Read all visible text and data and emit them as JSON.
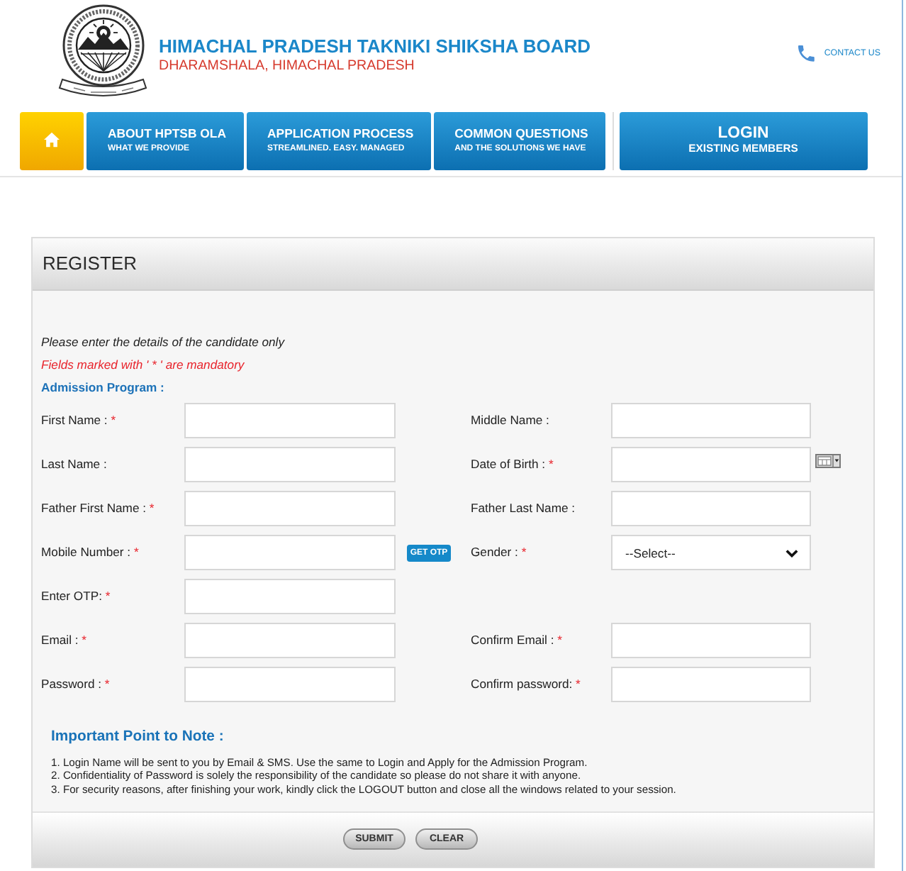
{
  "header": {
    "title": "HIMACHAL PRADESH TAKNIKI SHIKSHA BOARD",
    "subtitle": "DHARAMSHALA, HIMACHAL PRADESH",
    "contact": "CONTACT US"
  },
  "nav": [
    {
      "kind": "home",
      "selected": true
    },
    {
      "kind": "link",
      "label": "ABOUT HPTSB OLA",
      "sublabel": "WHAT WE PROVIDE",
      "selected": false
    },
    {
      "kind": "link",
      "label": "APPLICATION PROCESS",
      "sublabel": "STREAMLINED. EASY. MANAGED",
      "selected": false
    },
    {
      "kind": "link",
      "label": "COMMON QUESTIONS",
      "sublabel": "AND THE SOLUTIONS WE HAVE",
      "selected": false
    },
    {
      "kind": "login",
      "label": "LOGIN",
      "sublabel": "EXISTING MEMBERS",
      "selected": false
    }
  ],
  "register": {
    "title": "REGISTER",
    "intro": "Please enter the details of the candidate only",
    "mandatory_note": "Fields marked with ' * ' are mandatory",
    "section": "Admission Program :",
    "rows": [
      {
        "left": {
          "kind": "text",
          "label": "First Name :",
          "mark": "*"
        },
        "right": {
          "kind": "text",
          "label": "Middle Name :"
        }
      },
      {
        "left": {
          "kind": "text",
          "label": "Last Name :"
        },
        "right": {
          "kind": "date",
          "label": "Date of Birth :",
          "mark": "*"
        }
      },
      {
        "left": {
          "kind": "text",
          "label": "Father First Name :",
          "mark": "*"
        },
        "right": {
          "kind": "text",
          "label": "Father Last Name :"
        }
      },
      {
        "left": {
          "kind": "otp",
          "label": "Mobile Number :",
          "mark": "*",
          "button": "GET OTP"
        },
        "right": {
          "kind": "select",
          "label": "Gender :",
          "mark": "*",
          "value": "--Select--"
        }
      },
      {
        "left": {
          "kind": "text",
          "label": "Enter OTP:",
          "mark": "*"
        }
      },
      {
        "left": {
          "kind": "text",
          "label": "Email :",
          "mark": "*"
        },
        "right": {
          "kind": "text",
          "label": "Confirm Email :",
          "mark": "*"
        }
      },
      {
        "left": {
          "kind": "text",
          "label": "Password :",
          "mark": "*"
        },
        "right": {
          "kind": "text",
          "label": "Confirm password:",
          "mark": "*"
        }
      }
    ],
    "notes": {
      "title": "Important Point to Note :",
      "items": [
        "1. Login Name will be sent to you by Email & SMS. Use the same to Login and Apply for the Admission Program.",
        "2. Confidentiality of Password is solely the responsibility of the candidate so please do not share it with anyone.",
        "3. For security reasons, after finishing your work, kindly click the LOGOUT button and close all the windows related to your session."
      ]
    },
    "buttons": [
      "SUBMIT",
      "CLEAR"
    ]
  }
}
